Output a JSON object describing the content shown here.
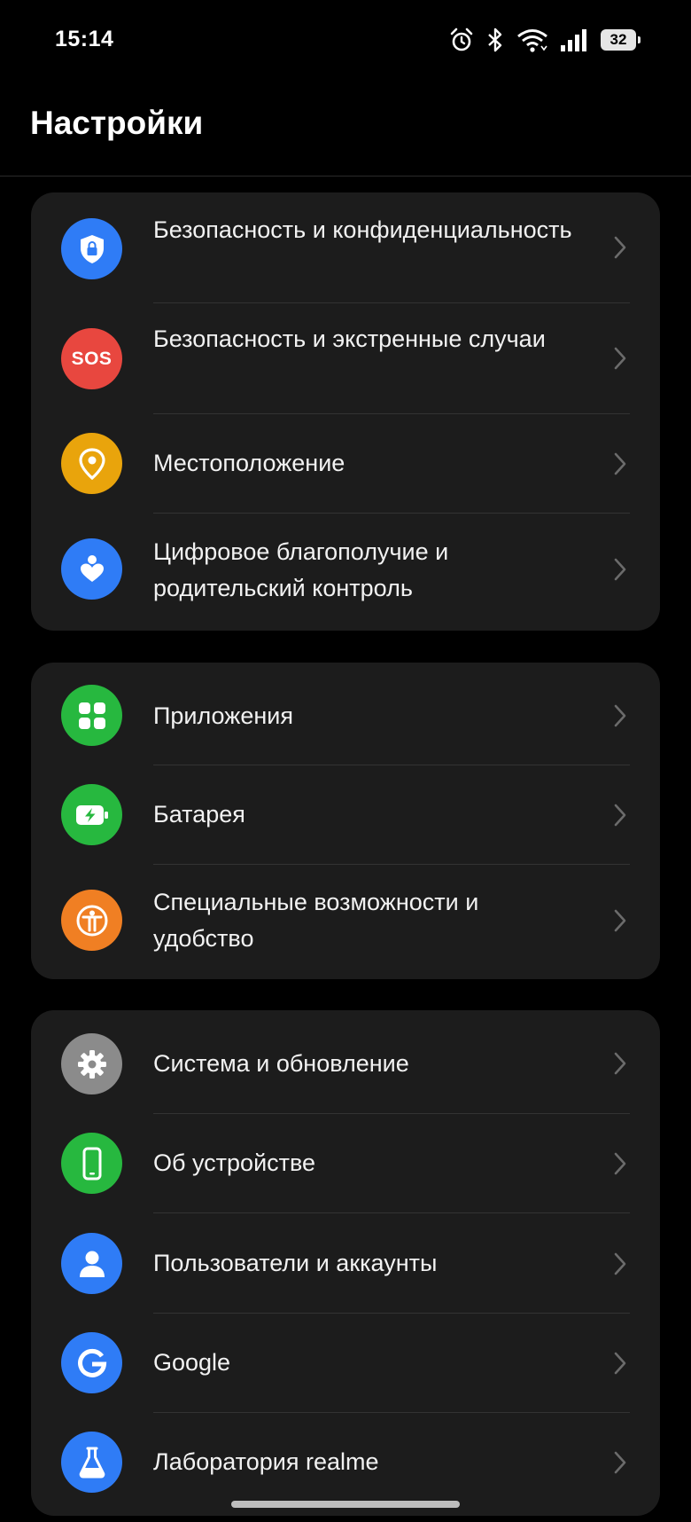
{
  "status_bar": {
    "time": "15:14",
    "battery_level": "32",
    "icons": [
      "alarm-icon",
      "bluetooth-icon",
      "wifi-icon",
      "signal-icon",
      "battery-icon"
    ]
  },
  "header": {
    "title": "Настройки"
  },
  "groups": [
    {
      "items": [
        {
          "label": "Безопасность и конфиденциальность",
          "icon": "shield-lock-icon",
          "color": "#2f7cf6"
        },
        {
          "label": "Безопасность и экстренные случаи",
          "icon": "sos-icon",
          "icon_text": "SOS",
          "color": "#e8473f"
        },
        {
          "label": "Местоположение",
          "icon": "location-pin-icon",
          "color": "#e9a40c"
        },
        {
          "label": "Цифровое благополучие и родительский контроль",
          "icon": "wellbeing-icon",
          "color": "#2f7cf6"
        }
      ]
    },
    {
      "items": [
        {
          "label": "Приложения",
          "icon": "apps-grid-icon",
          "color": "#27b83f"
        },
        {
          "label": "Батарея",
          "icon": "battery-charge-icon",
          "color": "#27b83f"
        },
        {
          "label": "Специальные возможности и удобство",
          "icon": "accessibility-icon",
          "color": "#f07f23"
        }
      ]
    },
    {
      "items": [
        {
          "label": "Система и обновление",
          "icon": "gear-icon",
          "color": "#8b8b8b"
        },
        {
          "label": "Об устройстве",
          "icon": "phone-icon",
          "color": "#27b83f"
        },
        {
          "label": "Пользователи и аккаунты",
          "icon": "user-icon",
          "color": "#2f7cf6"
        },
        {
          "label": "Google",
          "icon": "google-icon",
          "color": "#2f7cf6"
        },
        {
          "label": "Лаборатория realme",
          "icon": "flask-icon",
          "color": "#2f7cf6"
        }
      ]
    }
  ]
}
